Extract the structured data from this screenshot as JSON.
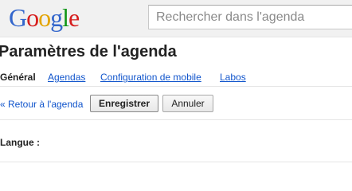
{
  "header": {
    "logo_letters": [
      {
        "char": "G",
        "color": "#3366cc"
      },
      {
        "char": "o",
        "color": "#d61d1d"
      },
      {
        "char": "o",
        "color": "#e3a400"
      },
      {
        "char": "g",
        "color": "#3366cc"
      },
      {
        "char": "l",
        "color": "#109618"
      },
      {
        "char": "e",
        "color": "#d61d1d"
      }
    ],
    "search": {
      "placeholder": "Rechercher dans l'agenda",
      "value": ""
    }
  },
  "page": {
    "title": "Paramètres de l'agenda"
  },
  "tabs": [
    {
      "label": "Général",
      "active": true
    },
    {
      "label": "Agendas",
      "active": false
    },
    {
      "label": "Configuration de mobile",
      "active": false
    },
    {
      "label": "Labos",
      "active": false
    }
  ],
  "actions": {
    "back_label": "« Retour à l'agenda",
    "save_label": "Enregistrer",
    "cancel_label": "Annuler"
  },
  "settings": {
    "language_label": "Langue :"
  },
  "colors": {
    "link": "#1155cc",
    "header_bg": "#f1f1f1"
  }
}
